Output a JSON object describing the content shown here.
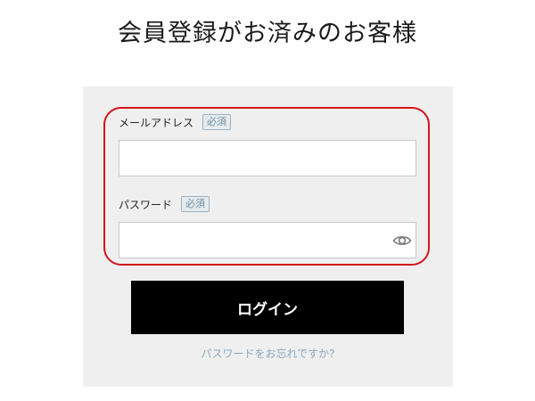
{
  "title": "会員登録がお済みのお客様",
  "form": {
    "email": {
      "label": "メールアドレス",
      "required_badge": "必須",
      "value": "",
      "placeholder": ""
    },
    "password": {
      "label": "パスワード",
      "required_badge": "必須",
      "value": "",
      "placeholder": ""
    },
    "login_label": "ログイン",
    "forgot_link": "パスワードをお忘れですか?"
  },
  "colors": {
    "highlight": "#d4141c",
    "panel_background": "#efefef",
    "button_background": "#000000",
    "link": "#8aa7bd"
  },
  "icons": {
    "password_toggle": "eye-icon"
  }
}
